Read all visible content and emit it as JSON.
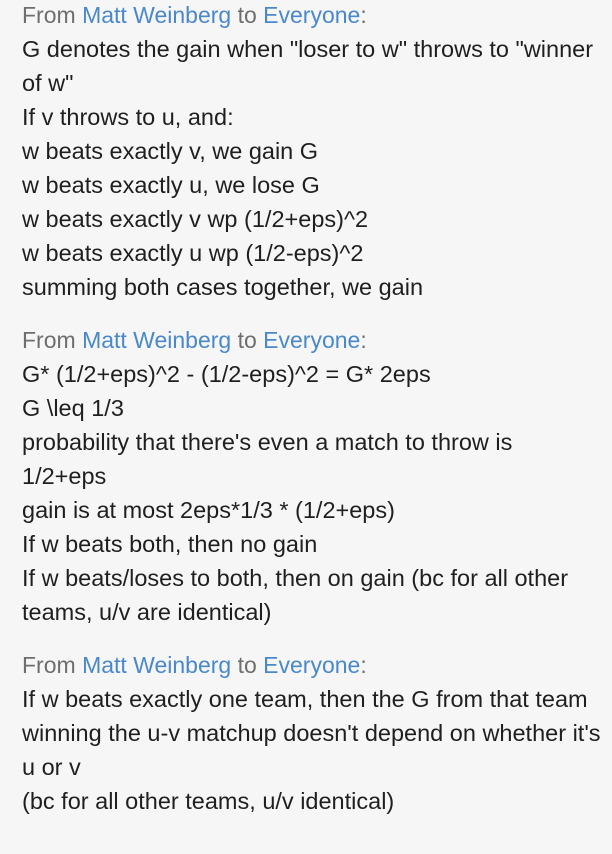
{
  "messages": [
    {
      "from_prefix": "From",
      "sender": "Matt Weinberg",
      "to_word": "to",
      "recipient": "Everyone",
      "colon": ":",
      "lines": [
        "G denotes the gain when \"loser to w\" throws to \"winner of w\"",
        "If v throws to u, and:",
        "w beats exactly v, we gain G",
        "w beats exactly u, we lose G",
        "w beats exactly v wp (1/2+eps)^2",
        "w beats exactly u wp (1/2-eps)^2",
        "summing both cases together, we gain"
      ]
    },
    {
      "from_prefix": "From",
      "sender": "Matt Weinberg",
      "to_word": "to",
      "recipient": "Everyone",
      "colon": ":",
      "lines": [
        "G* (1/2+eps)^2 - (1/2-eps)^2 = G* 2eps",
        "G \\leq 1/3",
        "probability that there's even a match to throw is 1/2+eps",
        "gain is at most 2eps*1/3 * (1/2+eps)",
        "If w beats both, then no gain",
        "If w beats/loses to both, then on gain (bc for all other teams, u/v are identical)"
      ]
    },
    {
      "from_prefix": "From",
      "sender": "Matt Weinberg",
      "to_word": "to",
      "recipient": "Everyone",
      "colon": ":",
      "lines": [
        "If w beats exactly one team, then the G from that team winning the u-v matchup doesn't depend on whether it's u or v",
        "(bc for all other teams, u/v identical)"
      ]
    }
  ],
  "colors": {
    "background": "#f6f6f6",
    "text": "#1f1f1f",
    "header_gray": "#6e6e6e",
    "name_blue": "#4a88cc"
  }
}
